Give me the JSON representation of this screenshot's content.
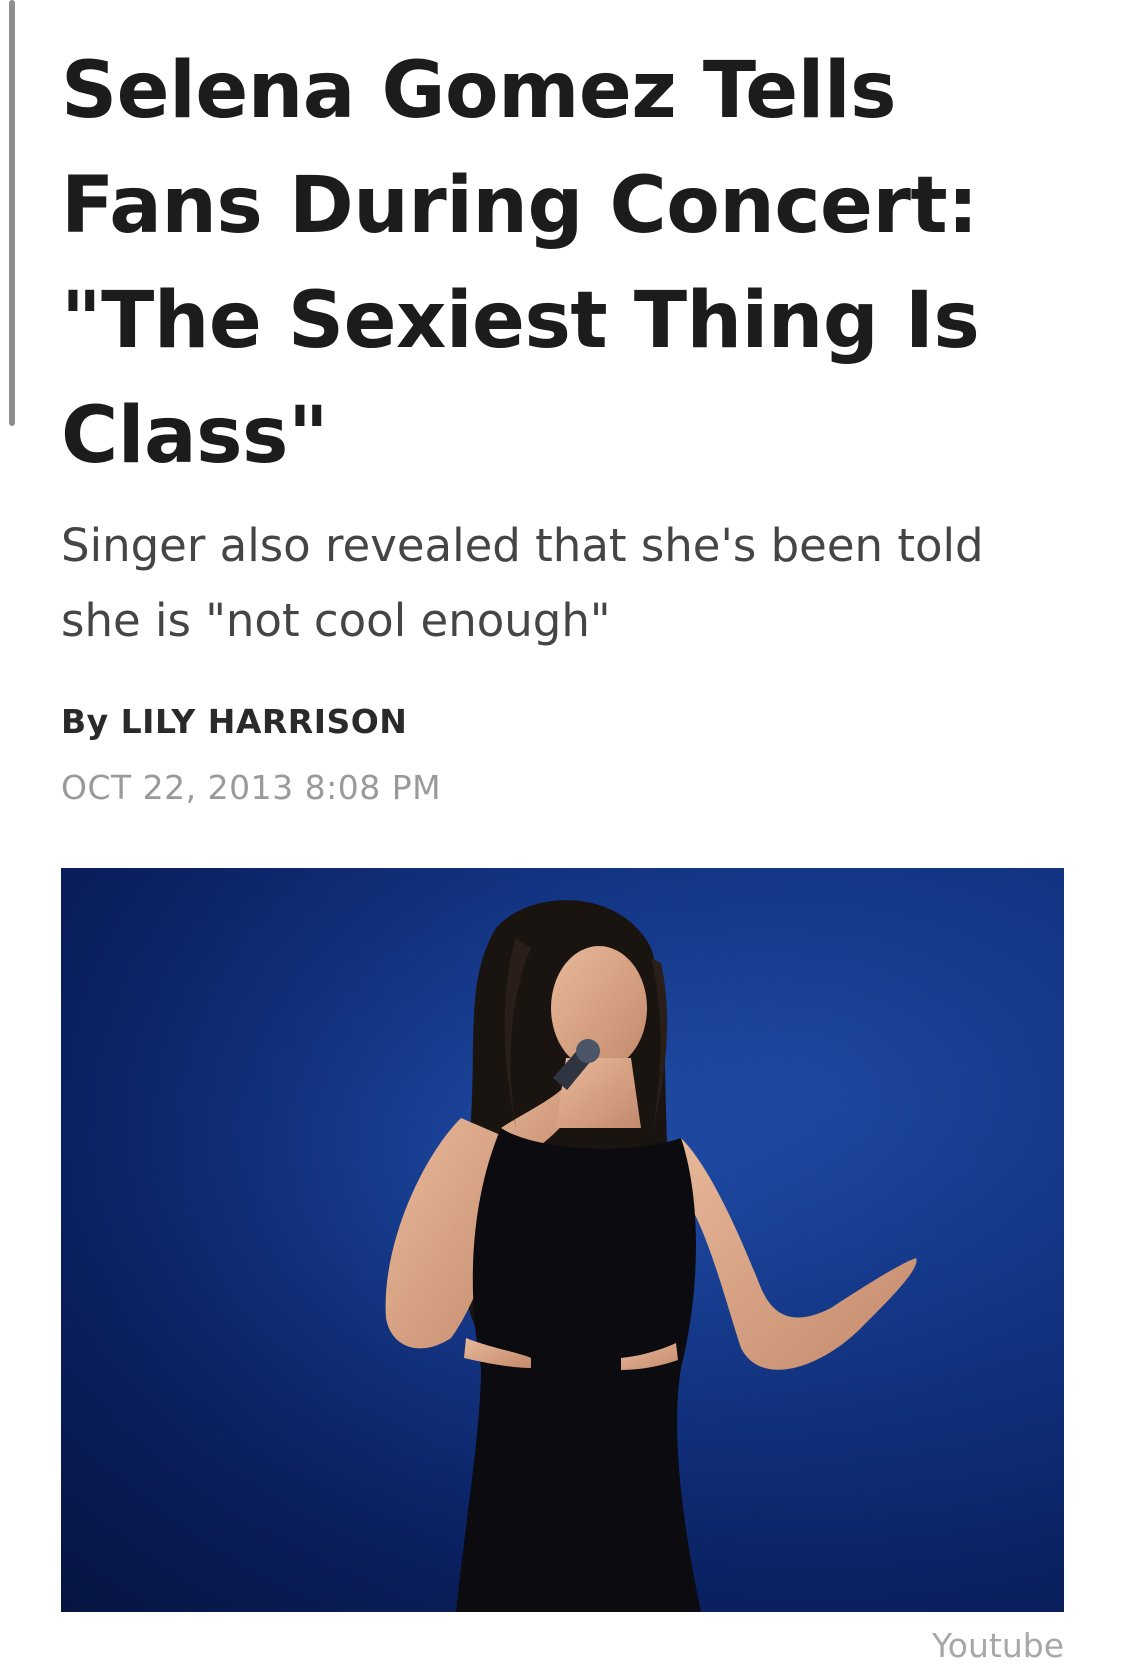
{
  "article": {
    "headline": "Selena Gomez Tells Fans During Concert: \"The Sexiest Thing Is Class\"",
    "subheadline": "Singer also revealed that she's been told she is \"not cool enough\"",
    "byline": "By LILY HARRISON",
    "date": "OCT 22, 2013 8:08 PM"
  },
  "hero_image": {
    "description_icon": "photo",
    "credit": "Youtube"
  },
  "colors": {
    "headline": "#1c1c1c",
    "subheadline": "#454545",
    "date": "#9a9a9a",
    "stage_blue": "#123584"
  }
}
